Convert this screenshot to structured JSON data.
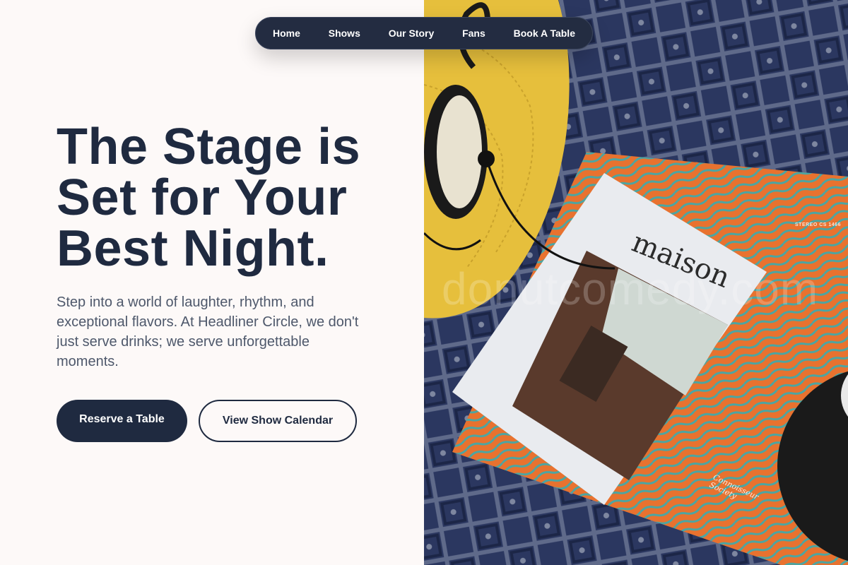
{
  "nav": {
    "items": [
      {
        "label": "Home"
      },
      {
        "label": "Shows"
      },
      {
        "label": "Our Story"
      },
      {
        "label": "Fans"
      },
      {
        "label": "Book A Table"
      }
    ]
  },
  "hero": {
    "title_lines": [
      "The Stage is",
      "Set for Your",
      "Best Night."
    ],
    "description": "Step into a world of laughter, rhythm, and exceptional flavors. At Headliner Circle, we don't just serve drinks; we serve unforgettable moments.",
    "primary_button": "Reserve a Table",
    "secondary_button": "View Show Calendar"
  },
  "image": {
    "watermark": "donutcomedy.com",
    "magazine_title": "maison",
    "record_label": "STEREO CS 1466",
    "cover_logo_line1": "Connoisseur",
    "cover_logo_line2": "Society"
  },
  "colors": {
    "primary": "#1f2a40",
    "background": "#fdf9f8",
    "text_muted": "#4e586b"
  }
}
